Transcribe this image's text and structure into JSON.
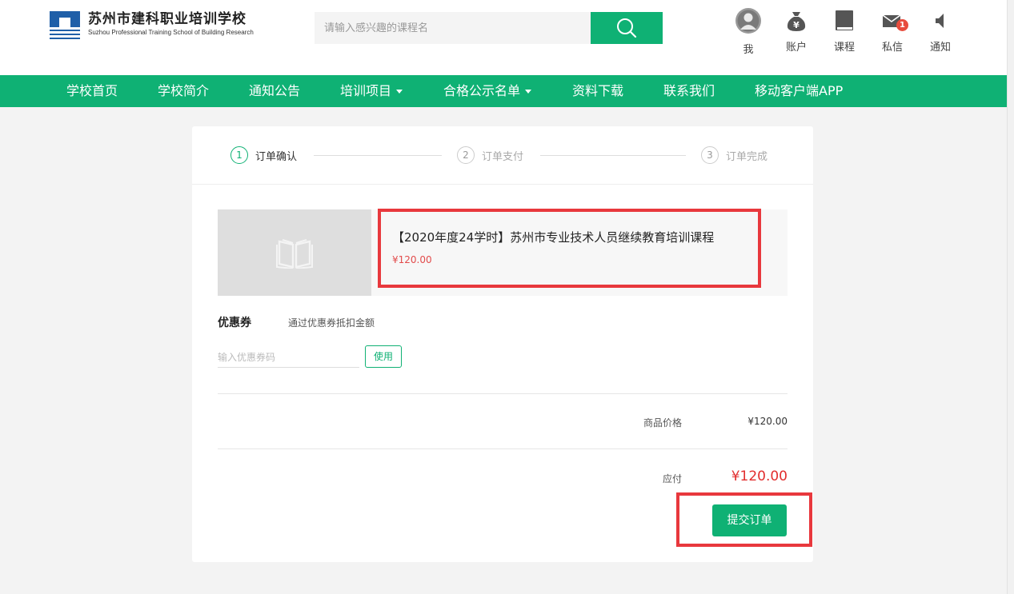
{
  "header": {
    "logo_cn": "苏州市建科职业培训学校",
    "logo_en": "Suzhou Professional Training School of Building Research",
    "search_placeholder": "请输入感兴趣的课程名",
    "icons": [
      {
        "label": "我",
        "icon": "user-avatar-icon"
      },
      {
        "label": "账户",
        "icon": "money-bag-icon"
      },
      {
        "label": "课程",
        "icon": "book-icon"
      },
      {
        "label": "私信",
        "icon": "mail-icon",
        "badge": "1"
      },
      {
        "label": "通知",
        "icon": "speaker-icon"
      }
    ]
  },
  "nav": {
    "items": [
      {
        "label": "学校首页"
      },
      {
        "label": "学校简介"
      },
      {
        "label": "通知公告"
      },
      {
        "label": "培训项目",
        "dropdown": true
      },
      {
        "label": "合格公示名单",
        "dropdown": true
      },
      {
        "label": "资料下载"
      },
      {
        "label": "联系我们"
      },
      {
        "label": "移动客户端APP"
      }
    ]
  },
  "steps": [
    {
      "num": "1",
      "label": "订单确认",
      "active": true
    },
    {
      "num": "2",
      "label": "订单支付",
      "active": false
    },
    {
      "num": "3",
      "label": "订单完成",
      "active": false
    }
  ],
  "order": {
    "product_title": "【2020年度24学时】苏州市专业技术人员继续教育培训课程",
    "product_price": "¥120.00",
    "coupon_label": "优惠券",
    "coupon_hint": "通过优惠券抵扣金额",
    "coupon_placeholder": "输入优惠券码",
    "use_button": "使用",
    "goods_price_label": "商品价格",
    "goods_price_value": "¥120.00",
    "pay_label": "应付",
    "pay_value": "¥120.00",
    "submit_button": "提交订单"
  },
  "colors": {
    "brand_green": "#0fb174",
    "highlight_red": "#e8383d",
    "price_red": "#e22e2e"
  }
}
